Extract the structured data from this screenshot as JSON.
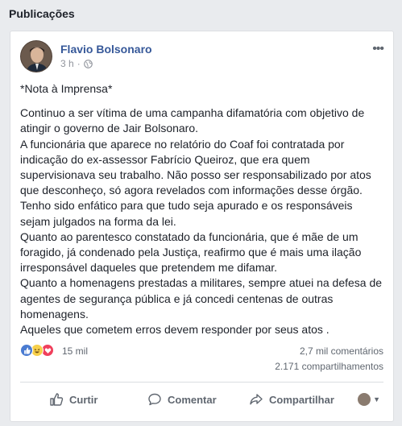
{
  "section": {
    "title": "Publicações"
  },
  "post": {
    "author": "Flavio Bolsonaro",
    "time": "3 h",
    "privacy_icon": "globe-icon",
    "heading": "*Nota à Imprensa*",
    "lines": [
      "Continuo a ser vítima de uma campanha difamatória com objetivo de",
      "atingir o governo de Jair Bolsonaro.",
      "A funcionária que aparece no relatório do Coaf foi contratada por",
      "indicação do ex-assessor Fabrício Queiroz, que era quem",
      "supervisionava seu trabalho. Não posso ser responsabilizado por atos",
      "que desconheço, só agora revelados com informações desse órgão.",
      "Tenho sido enfático para que tudo seja apurado e os responsáveis",
      "sejam julgados na forma da lei.",
      "Quanto ao parentesco constatado da funcionária, que é mãe de um",
      "foragido, já condenado pela Justiça, reafirmo que é mais uma ilação",
      "irresponsável daqueles que pretendem me difamar.",
      "Quanto a homenagens prestadas a militares, sempre atuei na defesa de",
      "agentes de segurança pública e já concedi centenas de outras",
      "homenagens.",
      "Aqueles que cometem erros devem responder por seus atos ."
    ]
  },
  "stats": {
    "reactions": "15 mil",
    "comments": "2,7 mil comentários",
    "shares": "2.171 compartilhamentos"
  },
  "actions": {
    "like": "Curtir",
    "comment": "Comentar",
    "share": "Compartilhar"
  },
  "colors": {
    "author_link": "#365899",
    "like_blue": "#4a7bd1",
    "love_red": "#f0405c",
    "haha_yellow": "#f7d04b"
  }
}
